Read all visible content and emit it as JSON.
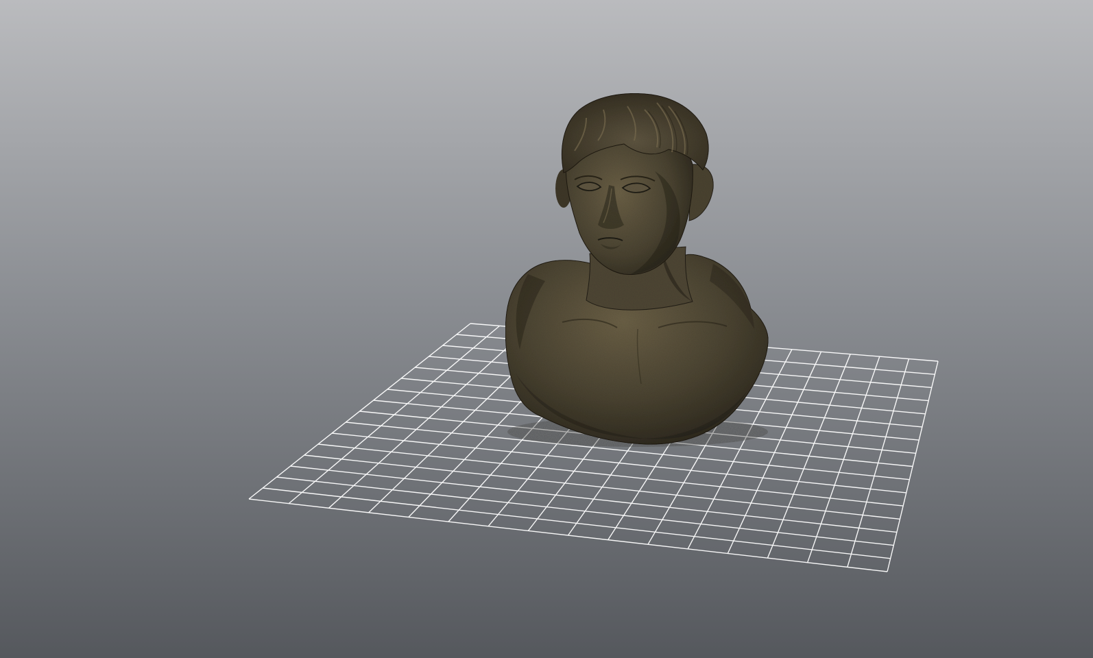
{
  "viewport": {
    "background_top": "#babbbe",
    "background_mid": "#8b8e93",
    "background_bottom": "#55585d",
    "grid_color": "#ffffff",
    "grid_divisions": 16
  },
  "model": {
    "subject": "bronze bust",
    "color_dark": "#262219",
    "color_base": "#4a4331",
    "color_light": "#6b6046"
  }
}
